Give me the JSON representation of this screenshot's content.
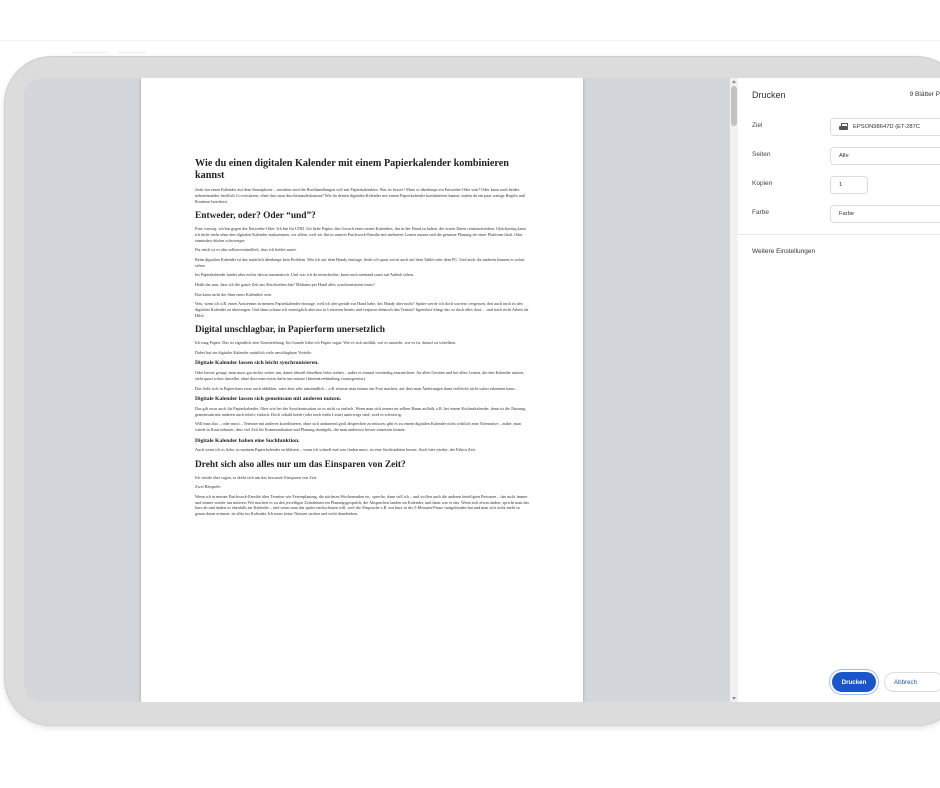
{
  "panel": {
    "title": "Drucken",
    "sheet_count": "9 Blätter P",
    "destination_label": "Ziel",
    "destination_value": "EPSON98647D (ET-287C",
    "pages_label": "Seiten",
    "pages_value": "Alle",
    "copies_label": "Kopien",
    "copies_value": "1",
    "color_label": "Farbe",
    "color_value": "Farbe",
    "more_settings": "Weitere Einstellungen",
    "print_button": "Drucken",
    "cancel_button": "Abbrech"
  },
  "document": {
    "title": "Wie du einen digitalen Kalender mit einem Papierkalender kombinieren kannst",
    "intro": "Jeder hat einen Kalender auf dem Smartphone – trotzdem sind die Buchhandlungen voll mit Papierkalendern. Was ist besser? Muss es überhaupt ein Entweder-Oder sein? Oder kann auch beides nebeneinander friedlich Co-existieren, ohne dass man durcheinanderkommt? Wie du deinen digitalen Kalender mit einem Papierkalender kombinieren kannst, indem du ein paar wenige Regeln und Routinen beachtest.",
    "h_either": "Entweder, oder? Oder “und”?",
    "p_either_1": "Eine vorweg: ich bin gegen das Entweder-Oder. Ich bin für UND. Ich liebe Papier, den Geruch eines neuen Kalenders, ihn in der Hand zu halten, die ersten Daten reinzuschreiben. Gleichzeitig kann ich nicht mehr ohne den digitalen Kalender auskommen, vor allem, weil wir ihn in unserer Patchwork-Familie mit mehreren Leuten nutzen und die gesamte Planung sie einer Plattform läuft. Oder zumindest dürfen schwieriger.",
    "p_either_2": "Für mich ist es also selbstverständlich, dass ich beides nutze.",
    "p_either_3": "Beim digitalen Kalender ist das natürlich überhaupt kein Problem. Was ich auf dem Handy eintrage, finde ich quasi sofort auch auf dem Tablet oder dem PC. Und auch die anderen können es sofort sehen.",
    "p_either_4": "Im Papierkalender landet aber nichts davon automatisch. Und was ich da reinschreibe, kann auch niemand sonst auf Anhieb sehen.",
    "p_either_5": "Heißt das nun, dass ich die ganze Zeit am Abschreiben bin? Mühsam per Hand alles synchronisieren muss?",
    "p_either_6": "Das kann nicht der Sinn eines Kalenders sein.",
    "p_either_7": "Was, wenn ich z.B. einen Arzttermin in meinen Papierkalender eintrage, weil ich den gerade zur Hand habe, das Handy aber nicht? Später werde ich doch sowieso vergessen, den auch noch in den digitalen Kalender zu übertragen. Und dann schaue ich womöglich aber nur in Letzteren hinein und verpasse dennoch den Termin? Irgendwie klingt das so doch alles doof… und nach recht Arbeit als Hilfe.",
    "h_digital": "Digital unschlagbar, in Papierform unersetzlich",
    "p_digital_1": "Ich mag Papier. Das ist eigentlich eine Untertreibung. Im Grunde liebe ich Papier sogar. Wie es sich anfühlt, wie es aussieht, wie es ist, darauf zu schreiben.",
    "p_digital_2": "Dabei hat ein digitaler Kalender natürlich viele unschlagbare Vorteile.",
    "h_sync": "Digitale Kalender lassen sich leicht synchronisieren.",
    "p_sync_1": "Oder besser gesagt: man muss gar nichts weiter tun, damit überall dieselben Infos stehen – außer es einmal vernünftig einzurichten. An allen Geräten und bei allen Leuten, die den Kalender nutzen, steht quasi sofort dasselbe, ohne dass man etwas dafür tun müsste (Internetverbindung vorausgesetzt).",
    "p_sync_2": "Das ließe sich in Papierform zwar auch abbilden, wäre aber sehr umständlich – z.B. müsste man immer ein Foto machen, auf dem man Änderungen dann vielleicht nicht sofort erkennen kann…",
    "h_share": "Digitale Kalender lassen sich gemeinsam mit anderen nutzen.",
    "p_share_1": "Das gilt zwar auch für Papierkalender. Aber wie bei der Synchronisation ist es nicht so einfach. Wenn man sich immer im selben Raum aufhält, z.B. bei einem Küchenkalender, dann ist die Nutzung gemeinsam mit anderen auch relativ einfach. Doch sobald beide (oder noch mehr Leute) unterwegs sind, wird es schwierig.",
    "p_share_2": "Will man also – oder muss – Termine mit anderen koordinieren, ohne sich andauernd groß absprechen zu müssen, gibt es zu einem digitalen Kalender nicht wirklich eine Alternative – außer, man würde in Kauf nehmen, dass viel Zeit für Kommunikation und Planung draufgeht, die man anderswo besser einsetzen könnte.",
    "h_search": "Digitale Kalender haben eine Suchfunktion.",
    "p_search_1": "Auch wenn ich es liebe, in meinem Papierkalender zu blättern – wenn ich schnell mal was finden muss, ist eine Suchfunktion besser. Auch hier wieder: der Faktor Zeit.",
    "h_time": "Dreht sich also alles nur um das Einsparen von Zeit?",
    "p_time_1": "Ich würde eher sagen, es dreht sich um das bewusste Einsparen von Zeit.",
    "p_time_2": "Zwei Beispiele:",
    "p_time_3": "Wenn ich in meiner Patchwork-Familie über Termine wie Ferienplanung, die nächsten Wochenenden etc. spreche, dann will ich – und wollen auch die anderen beteiligten Personen – das nicht immer und immer wieder tun müssen. Wir machen es zu den jeweiligen Zeitrahmen ein Planungsgespräch, die Absprachen landen im Kalender, und dann war es das. Wenn sich etwas ändert, spricht man das kurz ab und ändert es ebenfalls im Kalender – und wenn man das später nachschauen will, weil die Absprache z.B. nur kurz in der 5-Minuten-Pause stattgefunden hat und man sich nicht mehr so genau daran erinnert, ist alles im Kalender. Ich muss keine Notizen suchen und nicht drandenken."
  }
}
